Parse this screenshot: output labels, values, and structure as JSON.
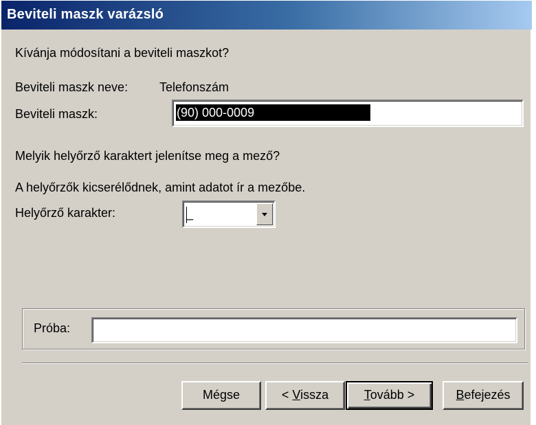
{
  "window": {
    "title": "Beviteli maszk varázsló"
  },
  "main": {
    "question": "Kívánja módosítani a beviteli maszkot?",
    "mask_name_label": "Beviteli maszk neve:",
    "mask_name_value": "Telefonszám",
    "mask_label": "Beviteli maszk:",
    "mask_value": "(90) 000-0009",
    "placeholder_question": "Melyik helyőrző karaktert jelenítse meg a mező?",
    "placeholder_info": "A helyőrzők kicserélődnek, amint adatot ír a mezőbe.",
    "placeholder_label": "Helyőrző karakter:",
    "placeholder_value": "_"
  },
  "sample": {
    "label": "Próba:",
    "value": ""
  },
  "buttons": {
    "cancel": "Mégse",
    "back_prefix": "< ",
    "back_mnemonic": "V",
    "back_rest": "issza",
    "next_mnemonic": "T",
    "next_rest": "ovább >",
    "finish_mnemonic": "B",
    "finish_rest": "efejezés"
  }
}
